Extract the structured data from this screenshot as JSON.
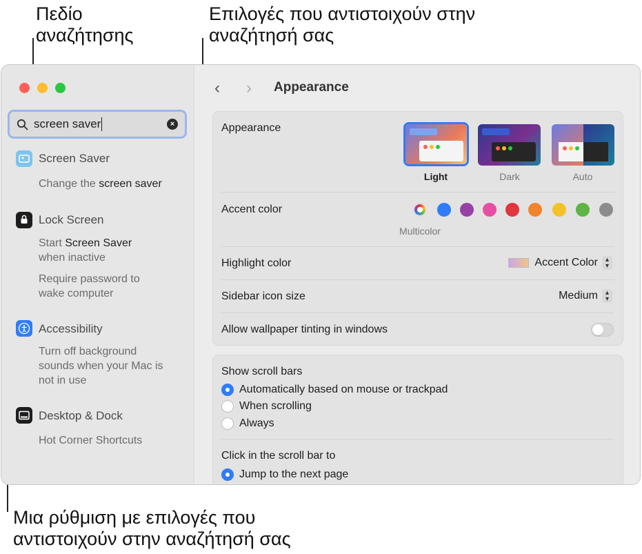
{
  "callouts": {
    "search_field": "Πεδίο\nαναζήτησης",
    "matching_options": "Επιλογές που αντιστοιχούν στην\nαναζήτησή σας",
    "setting_with_options": "Μια ρύθμιση με επιλογές που\nαντιστοιχούν στην αναζήτησή σας"
  },
  "search": {
    "value": "screen saver"
  },
  "sidebar": {
    "results": [
      {
        "title": "Screen Saver",
        "icon": "screen-saver-icon",
        "subs": [
          {
            "pre": "Change the ",
            "hl": "screen saver",
            "post": ""
          }
        ]
      },
      {
        "title": "Lock Screen",
        "icon": "lock-icon",
        "subs": [
          {
            "pre": "Start ",
            "hl": "Screen Saver",
            "post": "\nwhen inactive"
          },
          {
            "pre": "Require password to\nwake computer",
            "hl": "",
            "post": ""
          }
        ]
      },
      {
        "title": "Accessibility",
        "icon": "accessibility-icon",
        "subs": [
          {
            "pre": "Turn off background\nsounds when your Mac is\nnot in use",
            "hl": "",
            "post": ""
          }
        ]
      },
      {
        "title": "Desktop & Dock",
        "icon": "desktop-dock-icon",
        "subs": [
          {
            "pre": "Hot Corner Shortcuts",
            "hl": "",
            "post": ""
          }
        ]
      }
    ]
  },
  "content": {
    "title": "Appearance",
    "appearance": {
      "label": "Appearance",
      "options": [
        {
          "label": "Light",
          "selected": true
        },
        {
          "label": "Dark",
          "selected": false
        },
        {
          "label": "Auto",
          "selected": false
        }
      ]
    },
    "accent": {
      "label": "Accent color",
      "selected_name": "Multicolor",
      "colors": [
        "#a855f7",
        "#2f7cf6",
        "#9640a8",
        "#e44fa3",
        "#e0363e",
        "#f0852b",
        "#f5c12a",
        "#5cb544",
        "#8c8c8c"
      ]
    },
    "highlight": {
      "label": "Highlight color",
      "value": "Accent Color"
    },
    "icon_size": {
      "label": "Sidebar icon size",
      "value": "Medium"
    },
    "tinting": {
      "label": "Allow wallpaper tinting in windows",
      "on": false
    },
    "scroll": {
      "label": "Show scroll bars",
      "options": [
        {
          "label": "Automatically based on mouse or trackpad",
          "selected": true
        },
        {
          "label": "When scrolling",
          "selected": false
        },
        {
          "label": "Always",
          "selected": false
        }
      ]
    },
    "click": {
      "label": "Click in the scroll bar to",
      "options": [
        {
          "label": "Jump to the next page",
          "selected": true
        }
      ]
    }
  },
  "colors": {
    "accent_blue": "#2f7cf6",
    "search_ring": "#9ab7ea"
  }
}
